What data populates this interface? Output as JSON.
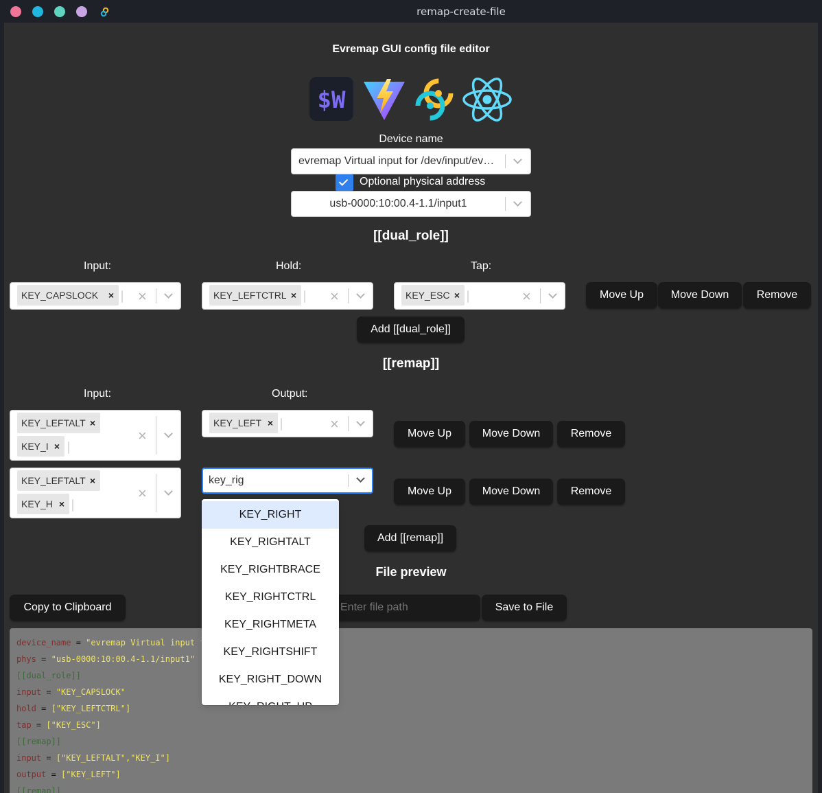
{
  "window": {
    "title": "remap-create-file",
    "dot_colors": [
      "#f07596",
      "#1fb6e0",
      "#5ed4c0",
      "#c9a4e4"
    ]
  },
  "app": {
    "heading": "Evremap GUI config file editor",
    "logos": [
      "wasm-icon",
      "vite-icon",
      "tauri-icon",
      "react-icon"
    ]
  },
  "device": {
    "label": "Device name",
    "value": "evremap Virtual input for /dev/input/ev…",
    "phys_checkbox_label": "Optional physical address",
    "phys_checked": true,
    "phys_value": "usb-0000:10:00.4-1.1/input1"
  },
  "dual_role": {
    "heading": "[[dual_role]]",
    "input_label": "Input:",
    "hold_label": "Hold:",
    "tap_label": "Tap:",
    "rows": [
      {
        "input": [
          "KEY_CAPSLOCK"
        ],
        "hold": [
          "KEY_LEFTCTRL"
        ],
        "tap": [
          "KEY_ESC"
        ]
      }
    ],
    "move_up": "Move Up",
    "move_down": "Move Down",
    "remove": "Remove",
    "add_button": "Add [[dual_role]]"
  },
  "remap": {
    "heading": "[[remap]]",
    "input_label": "Input:",
    "output_label": "Output:",
    "rows": [
      {
        "input": [
          "KEY_LEFTALT",
          "KEY_I"
        ],
        "output": [
          "KEY_LEFT"
        ]
      },
      {
        "input": [
          "KEY_LEFTALT",
          "KEY_H"
        ],
        "output_search": "key_rig"
      }
    ],
    "move_up": "Move Up",
    "move_down": "Move Down",
    "remove": "Remove",
    "add_button": "Add [[remap]]"
  },
  "dropdown": {
    "options": [
      "KEY_RIGHT",
      "KEY_RIGHTALT",
      "KEY_RIGHTBRACE",
      "KEY_RIGHTCTRL",
      "KEY_RIGHTMETA",
      "KEY_RIGHTSHIFT",
      "KEY_RIGHT_DOWN",
      "KEY_RIGHT_UP"
    ],
    "highlighted_index": 0
  },
  "file": {
    "heading": "File preview",
    "copy_button": "Copy to Clipboard",
    "path_placeholder": "Enter file path",
    "save_button": "Save to File"
  },
  "preview_lines": [
    {
      "key": "device_name",
      "value": "\"evremap Virtual input fo"
    },
    {
      "key": "phys",
      "value": "\"usb-0000:10:00.4-1.1/input1\""
    },
    {
      "table": "[[dual_role]]"
    },
    {
      "key": "input",
      "value": "\"KEY_CAPSLOCK\""
    },
    {
      "key": "hold",
      "value": "[\"KEY_LEFTCTRL\"]"
    },
    {
      "key": "tap",
      "value": "[\"KEY_ESC\"]"
    },
    {
      "table": "[[remap]]"
    },
    {
      "key": "input",
      "value": "[\"KEY_LEFTALT\",\"KEY_I\"]"
    },
    {
      "key": "output",
      "value": "[\"KEY_LEFT\"]"
    },
    {
      "table": "[[remap]]"
    }
  ]
}
